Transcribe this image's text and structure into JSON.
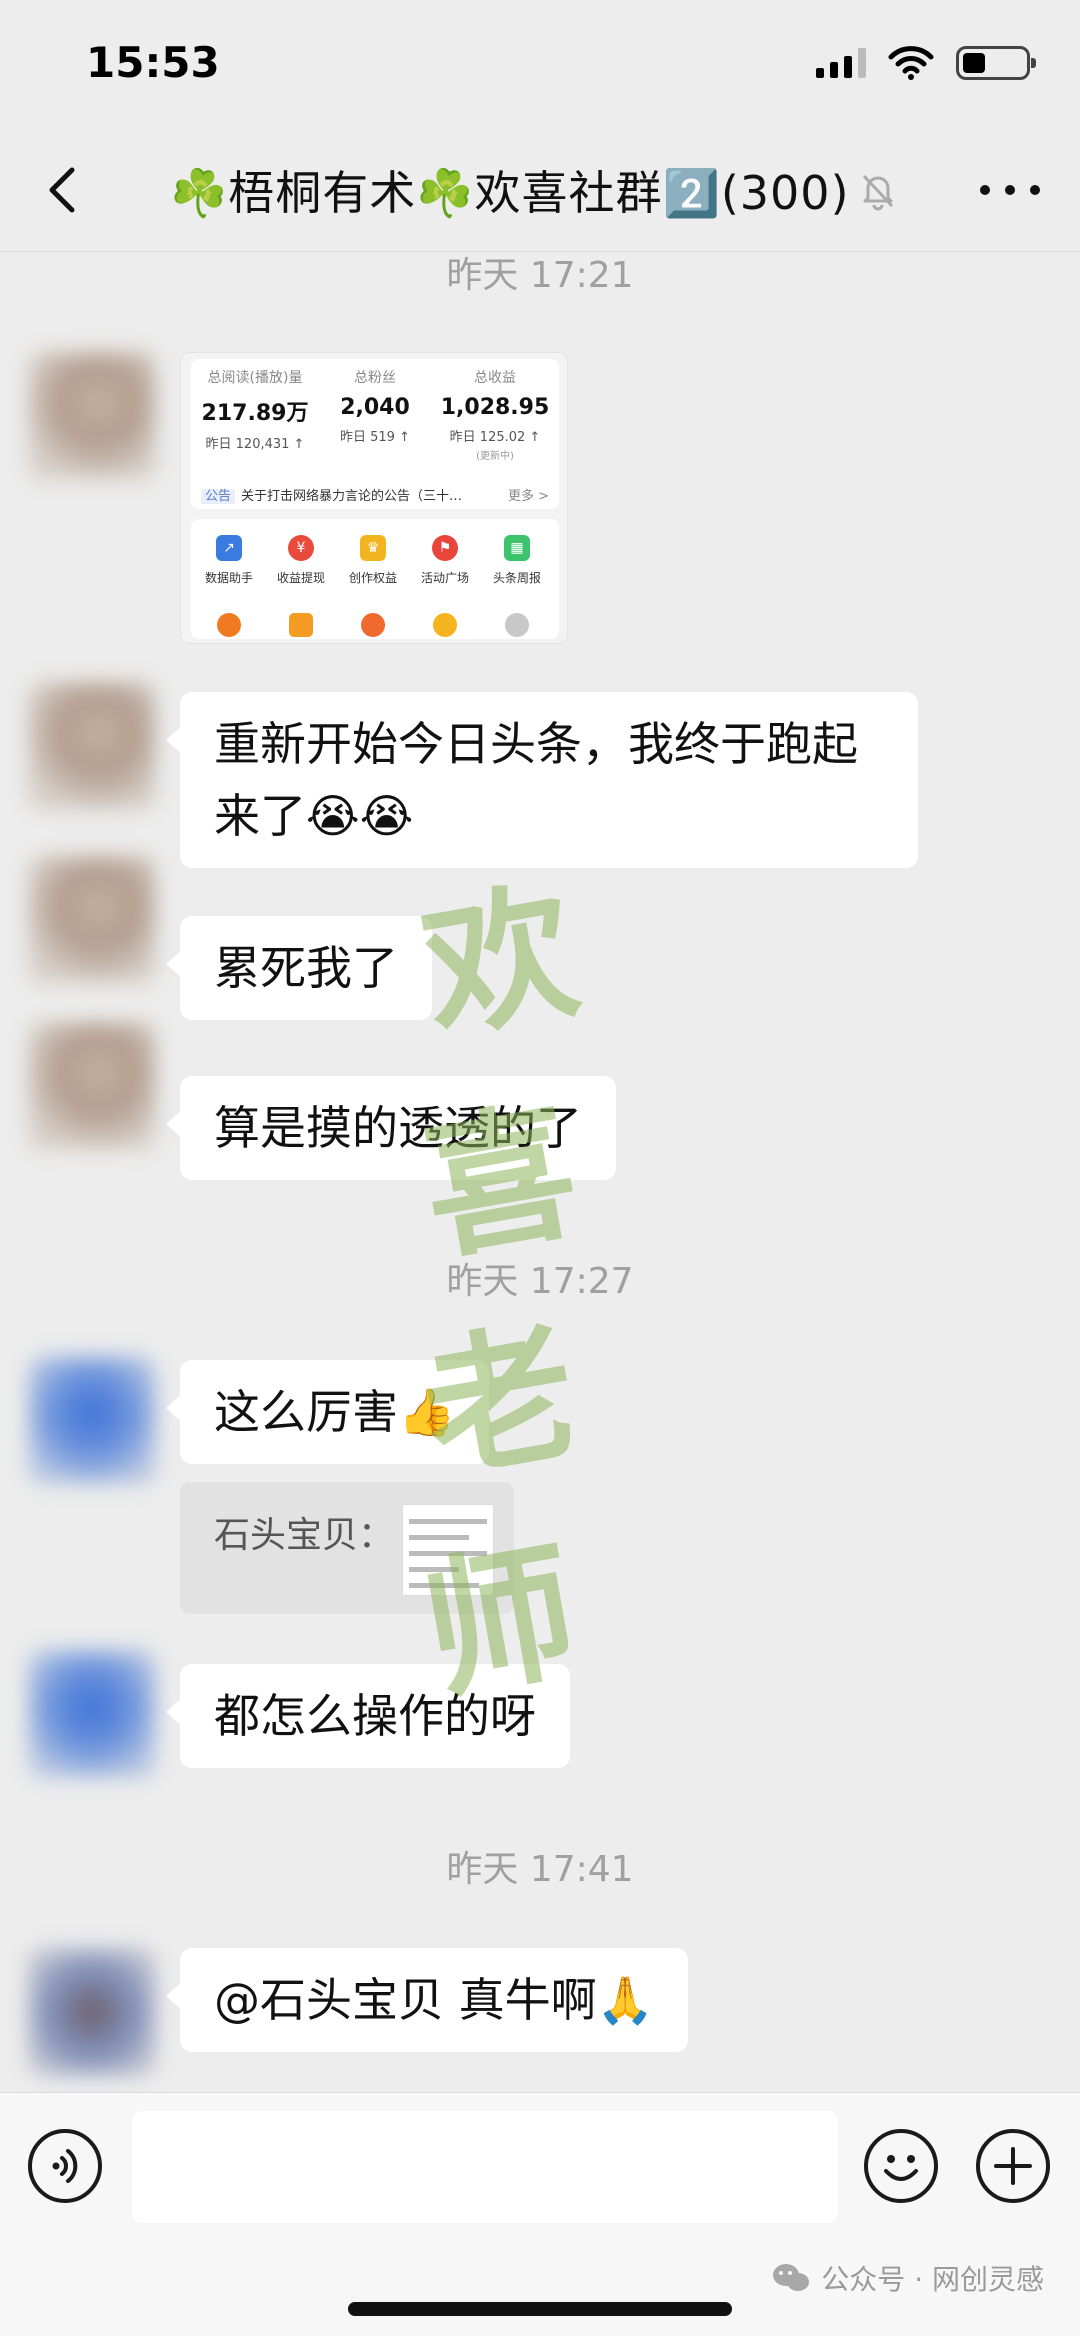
{
  "status_bar": {
    "time": "15:53"
  },
  "header": {
    "title": "☘️梧桐有术☘️欢喜社群2️⃣(300)"
  },
  "timestamps": [
    "昨天 17:21",
    "昨天 17:27",
    "昨天 17:41"
  ],
  "image_card": {
    "stats": [
      {
        "label": "总阅读(播放)量",
        "value": "217.89万",
        "delta": "昨日 120,431 ↑",
        "note": ""
      },
      {
        "label": "总粉丝",
        "value": "2,040",
        "delta": "昨日 519 ↑",
        "note": ""
      },
      {
        "label": "总收益",
        "value": "1,028.95",
        "delta": "昨日 125.02 ↑",
        "note": "(更新中)"
      }
    ],
    "notice_tag": "公告",
    "notice_text": "关于打击网络暴力言论的公告（三十…",
    "notice_more": "更多 >",
    "tools": [
      {
        "label": "数据助手",
        "icon": "chart-icon",
        "color": "#3a7be0"
      },
      {
        "label": "收益提现",
        "icon": "yuan-icon",
        "color": "#e84a3b"
      },
      {
        "label": "创作权益",
        "icon": "crown-icon",
        "color": "#f2b51f"
      },
      {
        "label": "活动广场",
        "icon": "flag-icon",
        "color": "#e8453c"
      },
      {
        "label": "头条周报",
        "icon": "calendar-icon",
        "color": "#3cc36b"
      }
    ]
  },
  "messages": [
    {
      "text": "重新开始今日头条，我终于跑起来了😭😭"
    },
    {
      "text": "累死我了"
    },
    {
      "text": "算是摸的透透的了"
    },
    {
      "text": "这么厉害👍"
    },
    {
      "text": "都怎么操作的呀"
    },
    {
      "text": "@石头宝贝 真牛啊🙏"
    }
  ],
  "quote": {
    "text": "石头宝贝："
  },
  "watermark": [
    "欢",
    "喜",
    "老",
    "师"
  ],
  "footer": {
    "account": "公众号 · 网创灵感"
  }
}
